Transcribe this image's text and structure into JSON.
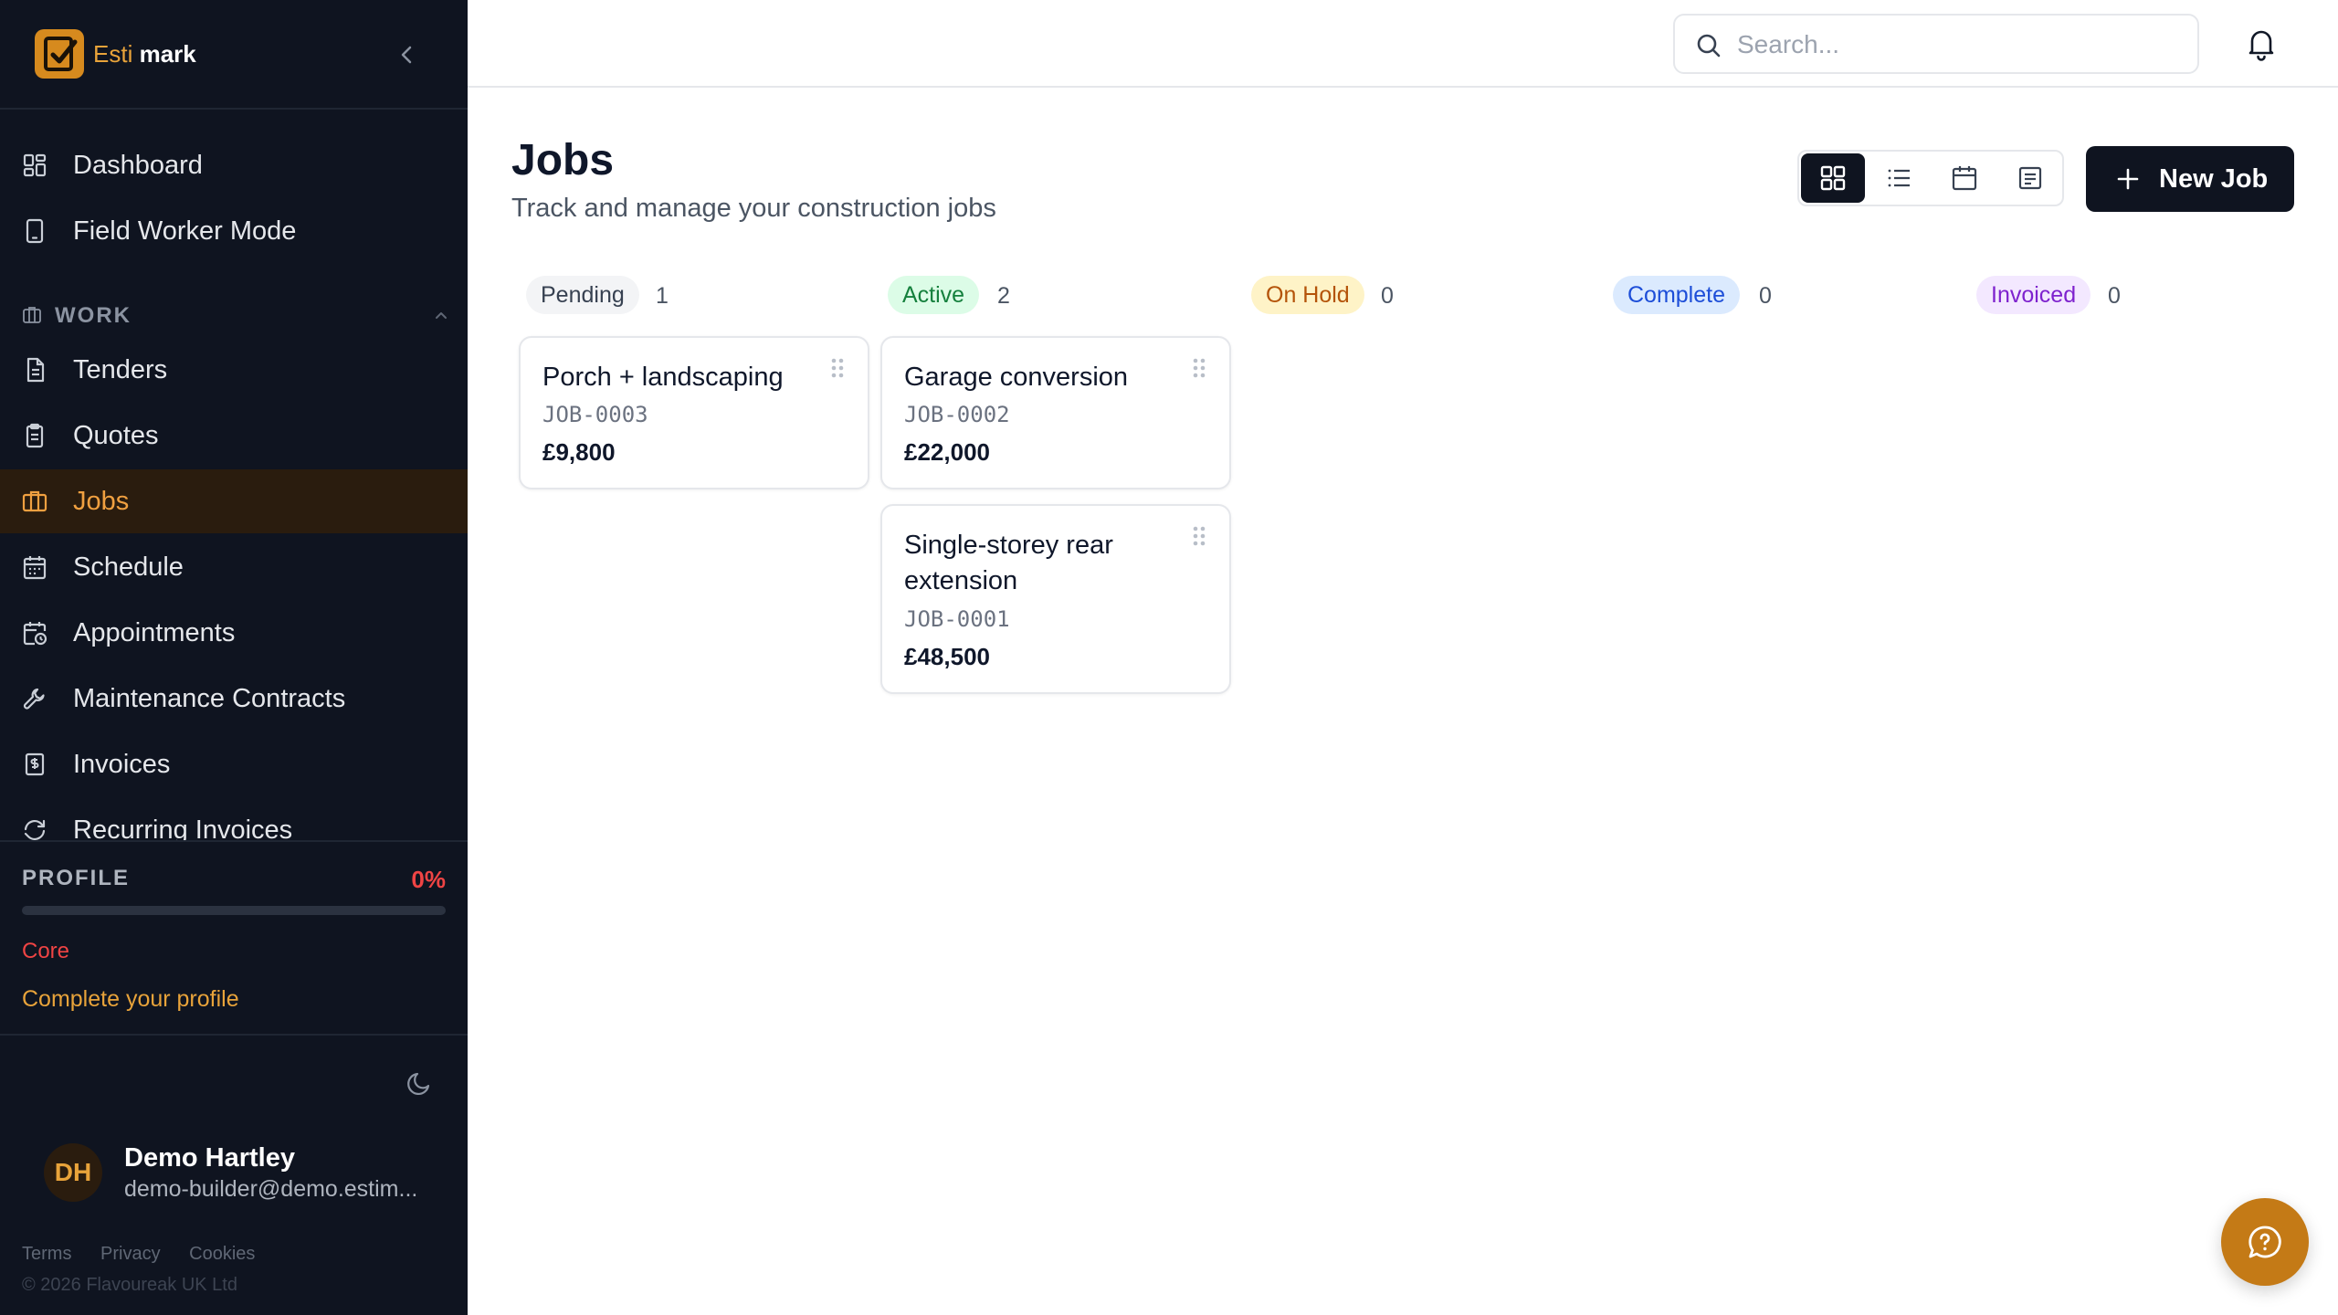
{
  "brand": {
    "name_part1": "Esti",
    "name_part2": "mark"
  },
  "sidebar": {
    "top_items": [
      {
        "label": "Dashboard",
        "icon": "layout-grid-icon"
      },
      {
        "label": "Field Worker Mode",
        "icon": "smartphone-icon"
      }
    ],
    "section": {
      "label": "WORK",
      "icon": "briefcase-icon",
      "expanded": true
    },
    "work_items": [
      {
        "label": "Tenders",
        "icon": "file-text-icon"
      },
      {
        "label": "Quotes",
        "icon": "clipboard-icon"
      },
      {
        "label": "Jobs",
        "icon": "briefcase-icon",
        "active": true
      },
      {
        "label": "Schedule",
        "icon": "calendar-icon"
      },
      {
        "label": "Appointments",
        "icon": "calendar-clock-icon"
      },
      {
        "label": "Maintenance Contracts",
        "icon": "wrench-icon"
      },
      {
        "label": "Invoices",
        "icon": "receipt-icon"
      },
      {
        "label": "Recurring Invoices",
        "icon": "refresh-icon"
      }
    ]
  },
  "profile": {
    "title": "PROFILE",
    "percent_label": "0%",
    "progress": 0,
    "level": "Core",
    "cta": "Complete your profile"
  },
  "user": {
    "initials": "DH",
    "name": "Demo Hartley",
    "email": "demo-builder@demo.estim..."
  },
  "footer": {
    "links": [
      "Terms",
      "Privacy",
      "Cookies"
    ],
    "copyright": "© 2026 Flavoureak UK Ltd"
  },
  "topbar": {
    "search_placeholder": "Search..."
  },
  "page": {
    "title": "Jobs",
    "subtitle": "Track and manage your construction jobs",
    "new_job_label": "New Job",
    "views": [
      "board-view",
      "list-view",
      "calendar-view",
      "document-view"
    ],
    "active_view": "board-view"
  },
  "columns": [
    {
      "label": "Pending",
      "count": "1",
      "bg": "#f3f4f6",
      "fg": "#374151"
    },
    {
      "label": "Active",
      "count": "2",
      "bg": "#dcfce7",
      "fg": "#15803d"
    },
    {
      "label": "On Hold",
      "count": "0",
      "bg": "#fef3c7",
      "fg": "#b45309"
    },
    {
      "label": "Complete",
      "count": "0",
      "bg": "#dbeafe",
      "fg": "#1d4ed8"
    },
    {
      "label": "Invoiced",
      "count": "0",
      "bg": "#f3e8ff",
      "fg": "#7e22ce"
    }
  ],
  "jobs": [
    {
      "title": "Porch + landscaping",
      "code": "JOB-0003",
      "amount": "£9,800",
      "column": "Pending"
    },
    {
      "title": "Garage conversion",
      "code": "JOB-0002",
      "amount": "£22,000",
      "column": "Active"
    },
    {
      "title": "Single-storey rear extension",
      "code": "JOB-0001",
      "amount": "£48,500",
      "column": "Active"
    }
  ],
  "colors": {
    "accent": "#e8a33a",
    "sidebar_bg": "#0f1420",
    "danger": "#ef4444"
  },
  "help_icon": "help-chat-icon"
}
